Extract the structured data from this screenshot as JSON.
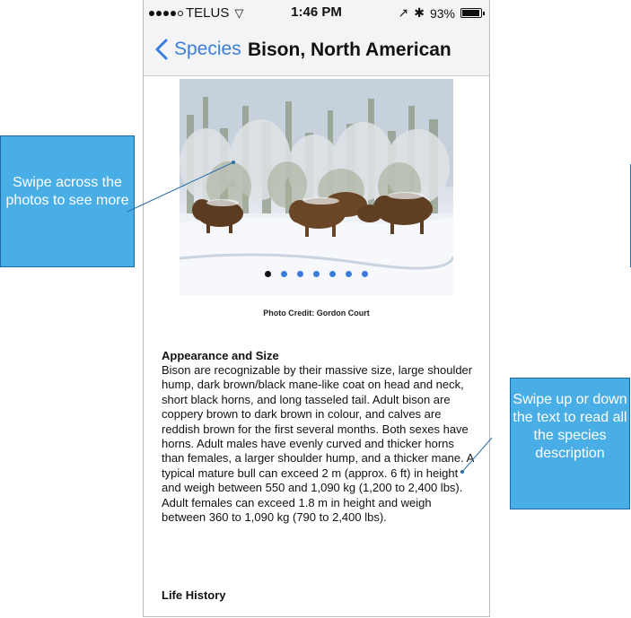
{
  "status_bar": {
    "carrier": "TELUS",
    "time": "1:46 PM",
    "battery": "93%",
    "battery_level": 0.93
  },
  "nav": {
    "back_label": "Species",
    "title": "Bison, North American"
  },
  "photo": {
    "credit": "Photo Credit: Gordon Court",
    "page_count": 7,
    "current_page": 1
  },
  "content": {
    "heading": "Appearance and Size",
    "body": "Bison are recognizable by their massive size, large shoulder hump, dark brown/black mane-like coat on head and neck, short black horns, and long tasseled tail. Adult bison are coppery brown to dark brown in colour, and calves are reddish brown for the first several months. Both sexes have horns. Adult males have evenly curved and thicker horns than females, a larger shoulder hump, and a thicker mane. A typical mature bull can exceed 2 m (approx. 6 ft) in height and weigh between 550 and 1,090 kg (1,200 to 2,400 lbs). Adult females can exceed 1.8 m in height and weigh between 360 to 1,090 kg (790 to 2,400 lbs).",
    "next_heading": "Life History"
  },
  "callouts": {
    "left": "Swipe across the photos to see more",
    "right": "Swipe up or down the text to read all the species description"
  },
  "colors": {
    "accent": "#3b7ddc",
    "callout": "#4aaee6"
  }
}
